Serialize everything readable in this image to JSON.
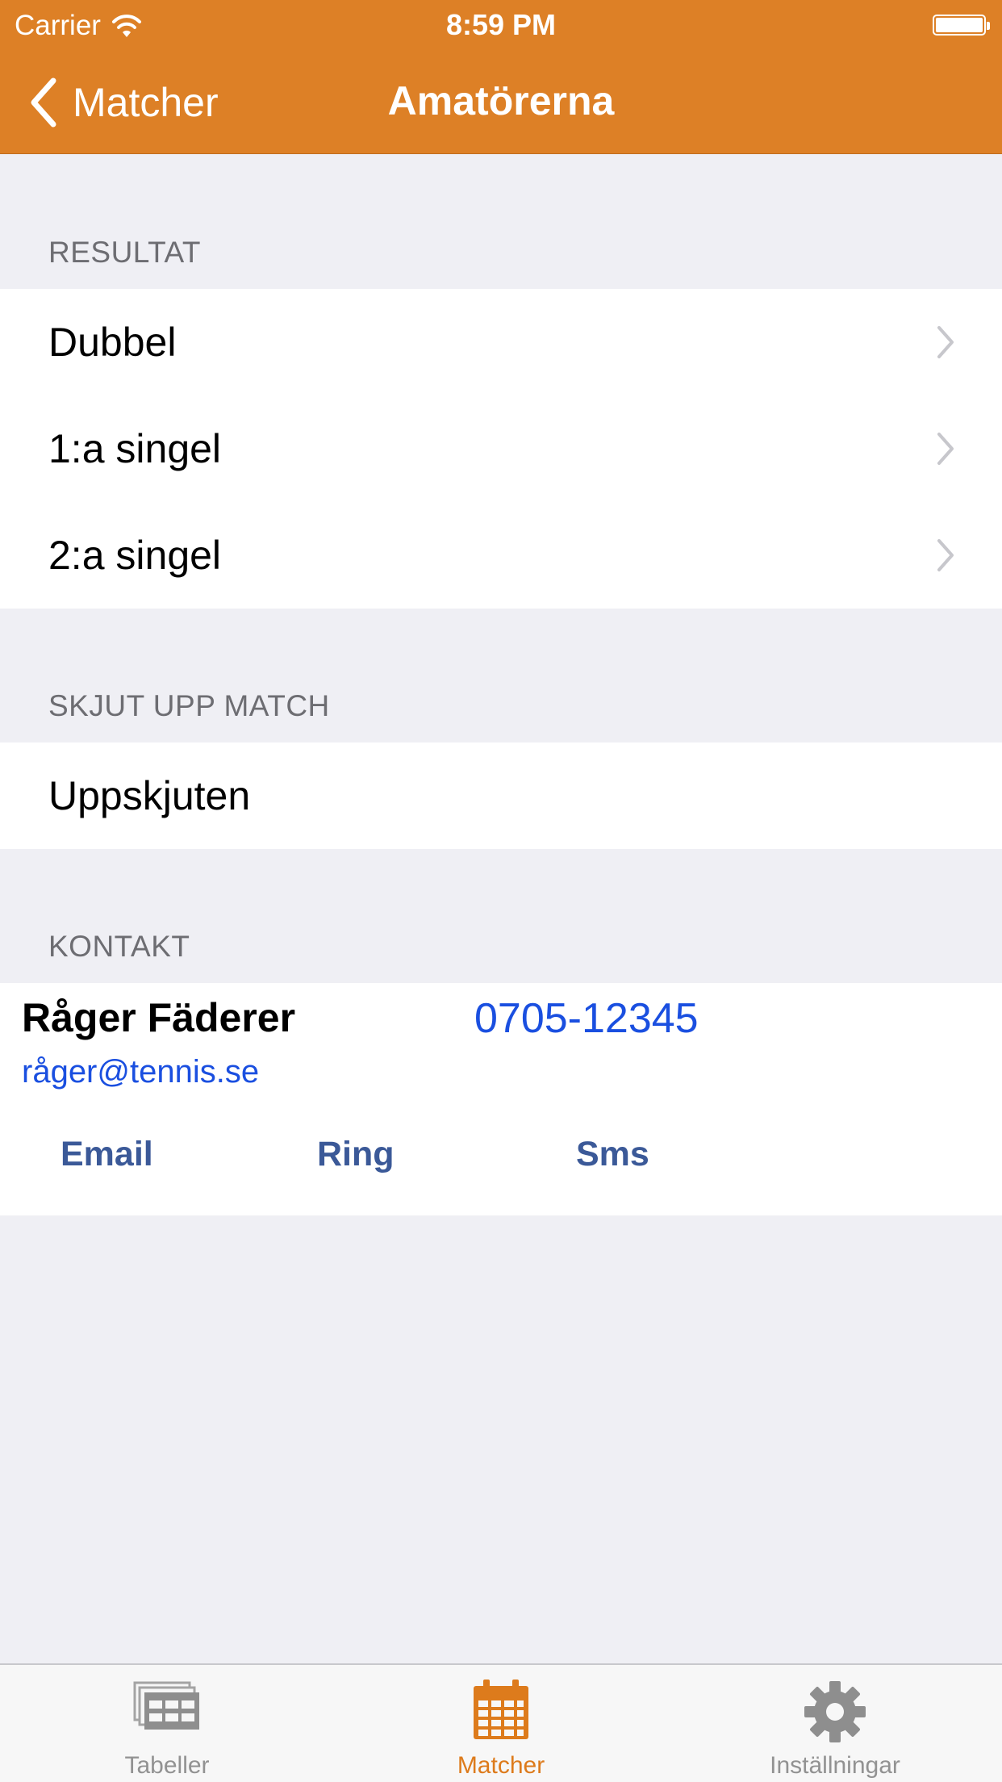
{
  "status_bar": {
    "carrier": "Carrier",
    "time": "8:59 PM"
  },
  "nav": {
    "back_label": "Matcher",
    "title": "Amatörerna"
  },
  "sections": {
    "resultat": {
      "header": "RESULTAT",
      "rows": [
        {
          "label": "Dubbel"
        },
        {
          "label": "1:a singel"
        },
        {
          "label": "2:a singel"
        }
      ]
    },
    "skjut_upp": {
      "header": "SKJUT UPP MATCH",
      "row_label": "Uppskjuten"
    },
    "kontakt": {
      "header": "KONTAKT",
      "name": "Råger Fäderer",
      "phone": "0705-12345",
      "email": "råger@tennis.se",
      "actions": {
        "email": "Email",
        "ring": "Ring",
        "sms": "Sms"
      }
    }
  },
  "tabbar": {
    "tabs": [
      {
        "label": "Tabeller",
        "icon": "table-icon",
        "active": false
      },
      {
        "label": "Matcher",
        "icon": "calendar-icon",
        "active": true
      },
      {
        "label": "Inställningar",
        "icon": "gear-icon",
        "active": false
      }
    ]
  },
  "colors": {
    "accent": "#dd8026",
    "link": "#1a4fe0",
    "action": "#3b5998",
    "background": "#efeff4"
  }
}
